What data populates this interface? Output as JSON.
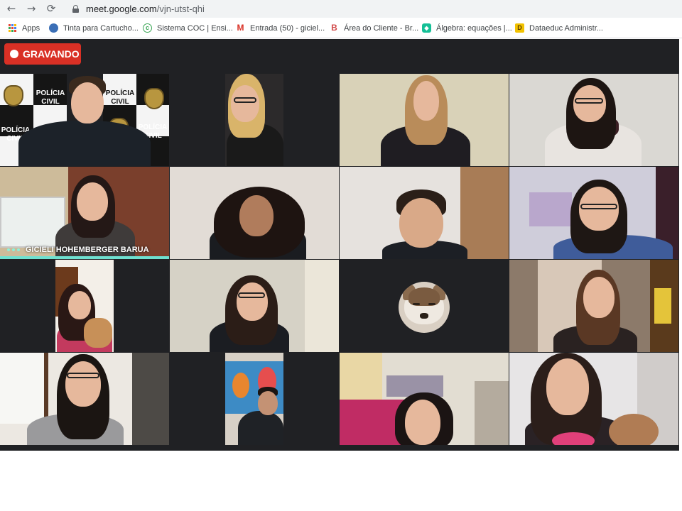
{
  "browser": {
    "url_domain": "meet.google.com",
    "url_path": "/vjn-utst-qhi",
    "back_icon": "←",
    "forward_icon": "→",
    "reload_icon": "⟳"
  },
  "bookmarks": [
    {
      "label": "Apps",
      "icon": "apps-grid-icon"
    },
    {
      "label": "Tinta para Cartucho...",
      "icon": "globe-icon",
      "color": "#3b6fb6"
    },
    {
      "label": "Sistema COC | Ensi...",
      "icon": "coc-icon",
      "color": "#3aa655",
      "glyph": "c"
    },
    {
      "label": "Entrada (50) - giciel...",
      "icon": "gmail-icon",
      "color": "#d93025",
      "glyph": "M"
    },
    {
      "label": "Área do Cliente - Br...",
      "icon": "b-icon",
      "color": "#d14b4b",
      "glyph": "B"
    },
    {
      "label": "Álgebra: equações |...",
      "icon": "khan-icon",
      "color": "#14bf96",
      "glyph": "◆"
    },
    {
      "label": "Dataeduc Administr...",
      "icon": "d-icon",
      "color": "#f2c200",
      "glyph": "D"
    }
  ],
  "meet": {
    "recording_label": "GRAVANDO",
    "colors": {
      "recording": "#d93025",
      "background": "#202124",
      "active_speaker": "#6ee0d0"
    },
    "police_text": [
      "POLÍCIA",
      "CIVIL"
    ],
    "participants": [
      {
        "tile": 1,
        "name": ""
      },
      {
        "tile": 2,
        "name": ""
      },
      {
        "tile": 3,
        "name": ""
      },
      {
        "tile": 4,
        "name": ""
      },
      {
        "tile": 5,
        "name": "GICIELI HOHEMBERGER BARUA",
        "active_speaker": true
      },
      {
        "tile": 6,
        "name": ""
      },
      {
        "tile": 7,
        "name": ""
      },
      {
        "tile": 8,
        "name": ""
      },
      {
        "tile": 9,
        "name": ""
      },
      {
        "tile": 10,
        "name": ""
      },
      {
        "tile": 11,
        "name": "",
        "avatar": "wolf-dog-avatar"
      },
      {
        "tile": 12,
        "name": ""
      },
      {
        "tile": 13,
        "name": ""
      },
      {
        "tile": 14,
        "name": ""
      },
      {
        "tile": 15,
        "name": ""
      },
      {
        "tile": 16,
        "name": ""
      }
    ]
  }
}
